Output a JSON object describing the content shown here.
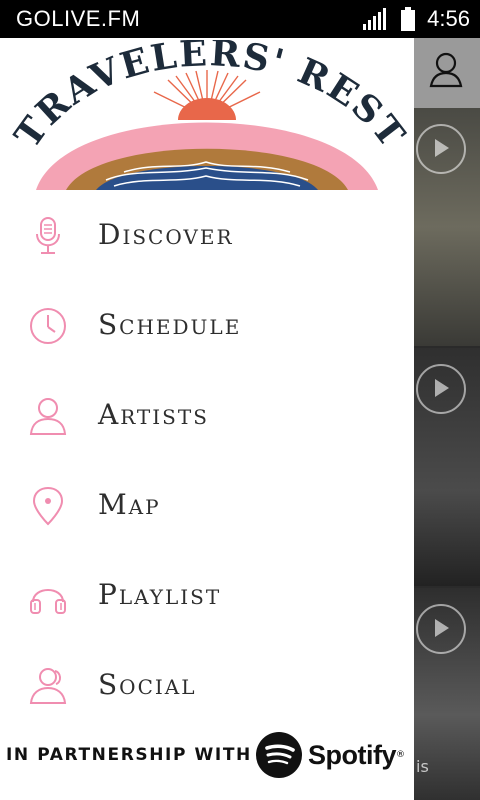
{
  "status_bar": {
    "app_name": "GOLIVE.FM",
    "time": "4:56"
  },
  "brand": {
    "logo_text": "TRAVELERS' REST"
  },
  "menu": [
    {
      "label": "Discover",
      "icon": "microphone-icon"
    },
    {
      "label": "Schedule",
      "icon": "clock-icon"
    },
    {
      "label": "Artists",
      "icon": "person-icon"
    },
    {
      "label": "Map",
      "icon": "map-pin-icon"
    },
    {
      "label": "Playlist",
      "icon": "headphones-icon"
    },
    {
      "label": "Social",
      "icon": "people-icon"
    }
  ],
  "partnership": {
    "text": "IN PARTNERSHIP WITH",
    "partner": "Spotify"
  },
  "background": {
    "caption_fragment": "is"
  },
  "colors": {
    "accent_pink": "#f08db0",
    "drawer_bg": "#ffffff",
    "status_bar_bg": "#000000"
  }
}
